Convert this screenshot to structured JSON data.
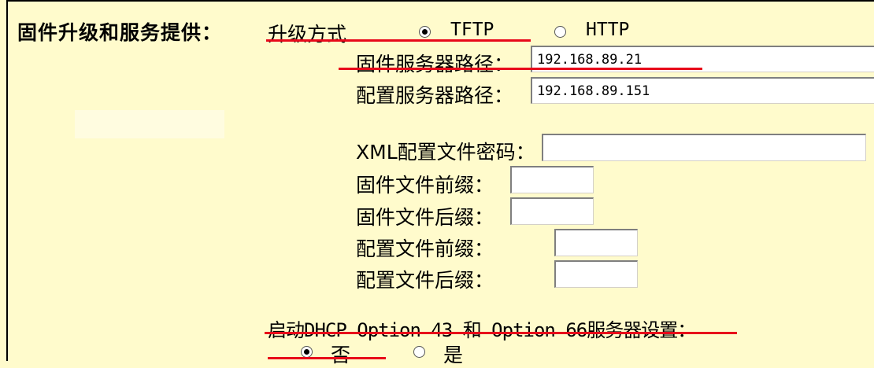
{
  "section": {
    "title": "固件升级和服务提供："
  },
  "upgrade_method": {
    "label": "升级方式",
    "options": [
      {
        "label": "TFTP",
        "selected": true
      },
      {
        "label": "HTTP",
        "selected": false
      }
    ]
  },
  "fields": {
    "firmware_server_path": {
      "label": "固件服务器路径：",
      "value": "192.168.89.21"
    },
    "config_server_path": {
      "label": "配置服务器路径：",
      "value": "192.168.89.151"
    },
    "xml_config_password": {
      "label": "XML配置文件密码：",
      "value": ""
    },
    "firmware_prefix": {
      "label": "固件文件前缀：",
      "value": ""
    },
    "firmware_suffix": {
      "label": "固件文件后缀：",
      "value": ""
    },
    "config_prefix": {
      "label": "配置文件前缀：",
      "value": ""
    },
    "config_suffix": {
      "label": "配置文件后缀：",
      "value": ""
    }
  },
  "dhcp": {
    "label": "启动DHCP Option 43 和 Option 66服务器设置：",
    "options": [
      {
        "label": "否",
        "selected": true
      },
      {
        "label": "是",
        "selected": false
      }
    ]
  },
  "colors": {
    "background": "#fffbcc",
    "annotation": "#e8091a"
  }
}
